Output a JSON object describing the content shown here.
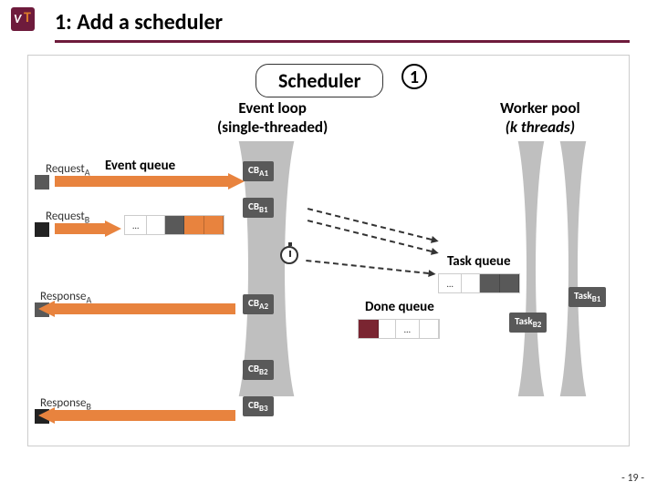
{
  "logo": {
    "vt": "V",
    "t": "T"
  },
  "title": "1: Add a scheduler",
  "page_number": "- 19 -",
  "scheduler": "Scheduler",
  "circle1": "1",
  "event_loop": {
    "line1": "Event loop",
    "line2": "(single-threaded)"
  },
  "worker_pool": {
    "line1": "Worker pool",
    "line2": "(k threads)"
  },
  "event_queue": "Event queue",
  "task_queue": "Task queue",
  "done_queue": "Done queue",
  "clients": {
    "request_a": "Request",
    "request_a_sub": "A",
    "request_b": "Request",
    "request_b_sub": "B",
    "response_a": "Response",
    "response_a_sub": "A",
    "response_b": "Response",
    "response_b_sub": "B"
  },
  "callbacks": {
    "cb_a1": {
      "base": "CB",
      "sub": "A1"
    },
    "cb_b1": {
      "base": "CB",
      "sub": "B1"
    },
    "cb_a2": {
      "base": "CB",
      "sub": "A2"
    },
    "cb_b2": {
      "base": "CB",
      "sub": "B2"
    },
    "cb_b3": {
      "base": "CB",
      "sub": "B3"
    }
  },
  "tasks": {
    "task_b1": {
      "base": "Task",
      "sub": "B1"
    },
    "task_b2": {
      "base": "Task",
      "sub": "B2"
    }
  },
  "ellipsis": "…",
  "colors": {
    "brand": "#6e1b3c",
    "accent": "#e8833e",
    "gray": "#595959"
  }
}
